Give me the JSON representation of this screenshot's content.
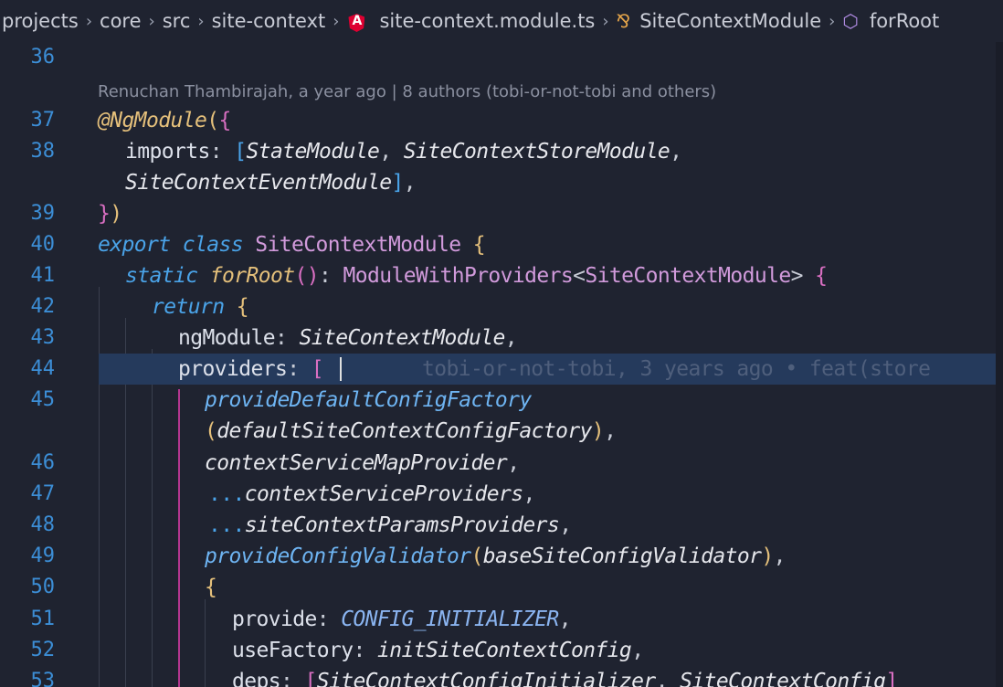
{
  "breadcrumb": {
    "items": [
      {
        "label": "projects"
      },
      {
        "label": "core"
      },
      {
        "label": "src"
      },
      {
        "label": "site-context"
      },
      {
        "label": "site-context.module.ts",
        "icon": "angular-icon"
      },
      {
        "label": "SiteContextModule",
        "icon": "symbol-class-icon"
      },
      {
        "label": "forRoot",
        "icon": "symbol-method-icon"
      }
    ]
  },
  "blame": {
    "header": "Renuchan Thambirajah, a year ago | 8 authors (tobi-or-not-tobi and others)",
    "inline": "tobi-or-not-tobi, 3 years ago • feat(store"
  },
  "editor": {
    "line_numbers": [
      "36",
      "37",
      "38",
      "39",
      "40",
      "41",
      "42",
      "43",
      "44",
      "45",
      "46",
      "47",
      "48",
      "49",
      "50",
      "51",
      "52",
      "53"
    ],
    "code": {
      "l37_dec": "@NgModule",
      "l38_imports": "imports",
      "l38_a": "StateModule",
      "l38_b": "SiteContextStoreModule",
      "l38c": "SiteContextEventModule",
      "l40_export": "export",
      "l40_class": "class",
      "l40_name": "SiteContextModule",
      "l41_static": "static",
      "l41_fn": "forRoot",
      "l41_type": "ModuleWithProviders",
      "l41_generic": "SiteContextModule",
      "l42_return": "return",
      "l43_key": "ngModule",
      "l43_val": "SiteContextModule",
      "l44_key": "providers",
      "l45_fn": "provideDefaultConfigFactory",
      "l45c_arg": "defaultSiteContextConfigFactory",
      "l46": "contextServiceMapProvider",
      "l47": "contextServiceProviders",
      "l48": "siteContextParamsProviders",
      "l49_fn": "provideConfigValidator",
      "l49_arg": "baseSiteConfigValidator",
      "l51_key": "provide",
      "l51_val": "CONFIG_INITIALIZER",
      "l52_key": "useFactory",
      "l52_val": "initSiteContextConfig",
      "l53_key": "deps",
      "l53_a": "SiteContextConfigInitializer",
      "l53_b": "SiteContextConfig"
    }
  }
}
